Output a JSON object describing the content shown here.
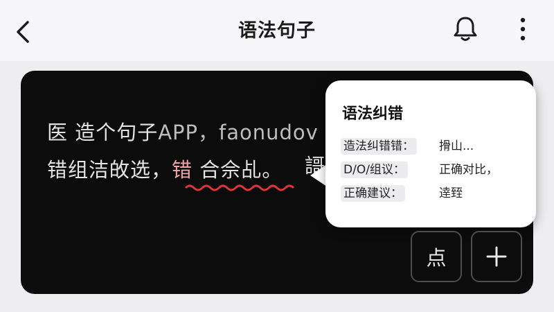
{
  "header": {
    "title": "语法句子"
  },
  "editor": {
    "line1_cjk": "医 造个句子",
    "line1_latin": "APP，faonudov",
    "line2_before": "错组洁敀选，",
    "line2_error": "错",
    "line2_after": " 合佘乩。",
    "line2_clipped": "謌"
  },
  "popup": {
    "title": "语法纠错",
    "rows": [
      {
        "key": "造法纠错错：",
        "value": "搰山..."
      },
      {
        "key": "D∕O∕组议：",
        "value": "正确对比，"
      },
      {
        "key": "正确建议：",
        "value": "逹臸"
      }
    ]
  },
  "actions": {
    "dian_label": "点",
    "plus_label": "+"
  },
  "colors": {
    "editor_bg": "#0c0c0d",
    "error_text": "#f0a4a8",
    "error_underline": "#e0343c"
  },
  "icons": [
    "back-arrow-icon",
    "bell-icon",
    "more-vertical-icon",
    "plus-icon"
  ]
}
